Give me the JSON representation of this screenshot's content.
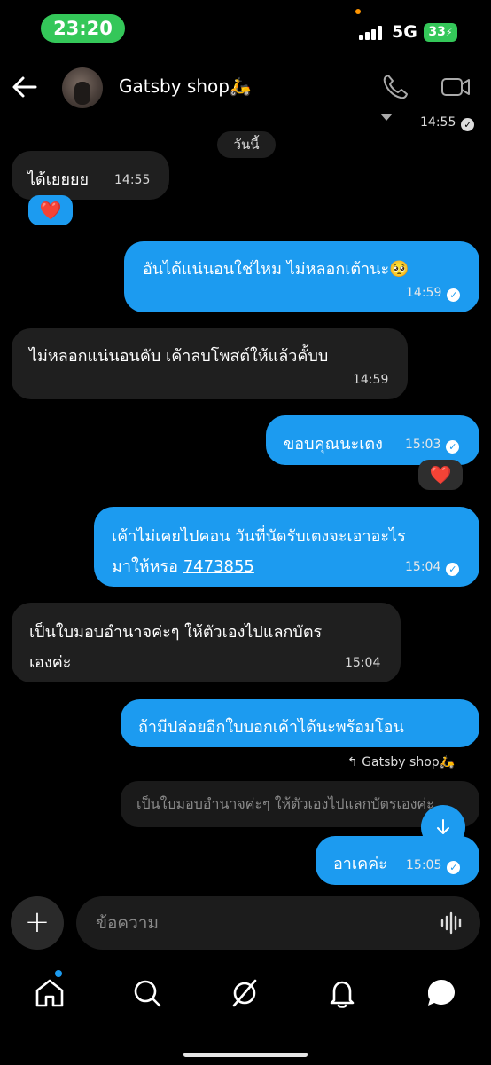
{
  "status_bar": {
    "time": "23:20",
    "network": "5G",
    "battery": "33"
  },
  "header": {
    "contact_name": "Gatsby shop🛵",
    "last_time": "14:55"
  },
  "date_label": "วันนี้",
  "messages": [
    {
      "direction": "in",
      "text": "ได้เยยยย",
      "time": "14:55",
      "reaction": "❤️"
    },
    {
      "direction": "out",
      "text": "อันได้แน่นอนใช่ไหม ไม่หลอกเต้านะ🥺",
      "time": "14:59"
    },
    {
      "direction": "in",
      "text": "ไม่หลอกแน่นอนคับ เค้าลบโพสต์ให้แล้วคั้บบ",
      "time": "14:59"
    },
    {
      "direction": "out",
      "text": "ขอบคุณนะเตง",
      "time": "15:03",
      "reaction": "❤️"
    },
    {
      "direction": "out",
      "lines": [
        "เค้าไม่เคยไปคอน วันที่นัดรับเตงจะเอาอะไร",
        "มาให้หรอ"
      ],
      "link": "7473855",
      "time": "15:04"
    },
    {
      "direction": "in",
      "lines": [
        "เป็นใบมอบอำนาจค่ะๆ ให้ตัวเองไปแลกบัตร",
        "เองค่ะ"
      ],
      "time": "15:04"
    },
    {
      "direction": "out",
      "text": "ถ้ามีปล่อยอีกใบบอกเค้าได้นะพร้อมโอน"
    },
    {
      "direction": "out",
      "text": "อาเคค่ะ",
      "time": "15:05"
    }
  ],
  "reply": {
    "reply_to": "Gatsby shop🛵",
    "quoted_text": "เป็นใบมอบอำนาจค่ะๆ ให้ตัวเองไปแลกบัตรเองค่ะ"
  },
  "composer": {
    "placeholder": "ข้อความ"
  },
  "nav": {
    "items": [
      "home-icon",
      "search-icon",
      "spaces-icon",
      "notifications-icon",
      "messages-icon"
    ]
  },
  "colors": {
    "accent": "#1c9bf0",
    "incoming_bubble": "#1f1f1f",
    "status_pill": "#34c759"
  }
}
